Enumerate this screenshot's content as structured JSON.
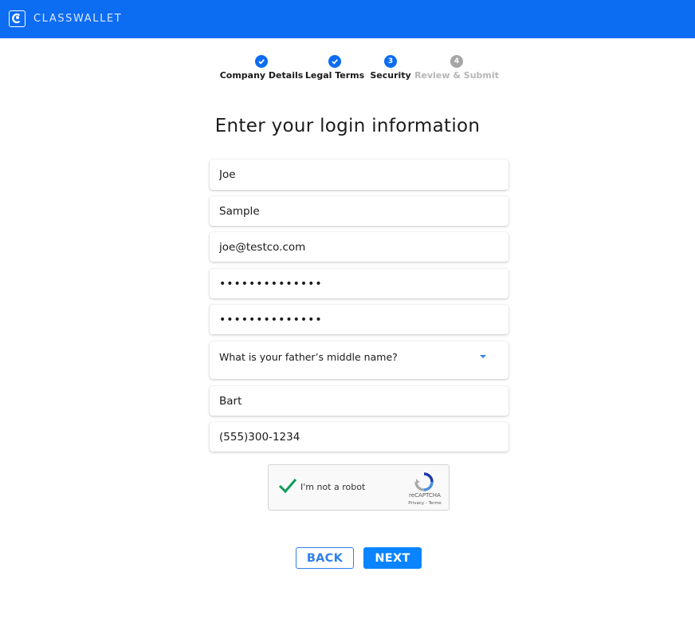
{
  "header": {
    "brand": "CLASSWALLET",
    "logo_icon": "classwallet-logo-icon",
    "background": "#0c6cf2"
  },
  "stepper": {
    "steps": [
      {
        "label": "Company Details",
        "status": "done",
        "marker": ""
      },
      {
        "label": "Legal Terms",
        "status": "done",
        "marker": ""
      },
      {
        "label": "Security",
        "status": "active",
        "marker": "3"
      },
      {
        "label": "Review & Submit",
        "status": "todo",
        "marker": "4"
      }
    ]
  },
  "form": {
    "title": "Enter your login information",
    "first_name": "Joe",
    "last_name": "Sample",
    "email": "joe@testco.com",
    "password": "••••••••••••••",
    "confirm_password": "••••••••••••••",
    "security_question": "What is your father’s middle name?",
    "security_answer": "Bart",
    "phone": "(555)300-1234"
  },
  "captcha": {
    "label": "I'm not a robot",
    "brand": "reCAPTCHA",
    "links": "Privacy - Terms",
    "checked": true,
    "check_color": "#0f9d58"
  },
  "actions": {
    "back_label": "BACK",
    "next_label": "NEXT",
    "accent": "#0a84ff"
  }
}
